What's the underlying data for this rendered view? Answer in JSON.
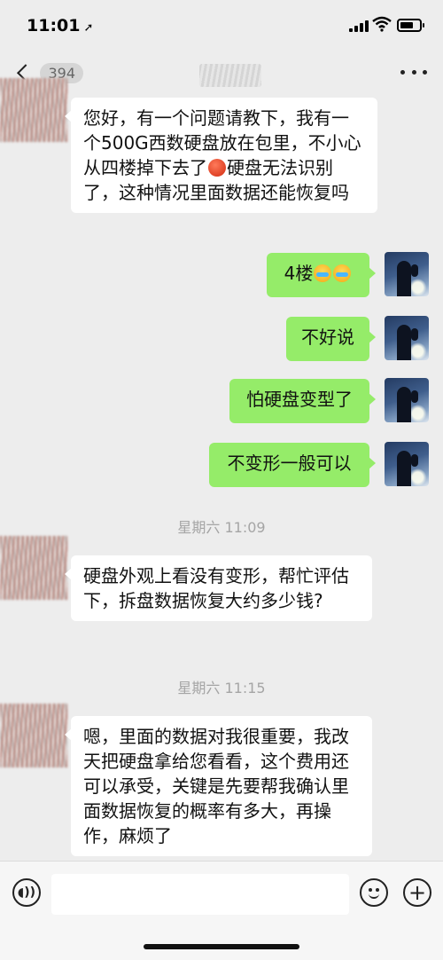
{
  "status": {
    "time": "11:01"
  },
  "nav": {
    "unread_count": "394"
  },
  "messages": [
    {
      "side": "in",
      "text_a": "您好，有一个问题请教下，我有一个500G西数硬盘放在包里，不小心从四楼掉下去了",
      "text_b": "硬盘无法识别了，这种情况里面数据还能恢复吗"
    },
    {
      "side": "out",
      "text": "4楼"
    },
    {
      "side": "out",
      "text": "不好说"
    },
    {
      "side": "out",
      "text": "怕硬盘变型了"
    },
    {
      "side": "out",
      "text": "不变形一般可以"
    },
    {
      "side": "in",
      "text": "硬盘外观上看没有变形，帮忙评估下，拆盘数据恢复大约多少钱?"
    },
    {
      "side": "in",
      "text": "嗯，里面的数据对我很重要，我改天把硬盘拿给您看看，这个费用还可以承受，关键是先要帮我确认里面数据恢复的概率有多大，再操作，麻烦了"
    }
  ],
  "timestamps": [
    "星期六 11:09",
    "星期六 11:15"
  ],
  "icons": {
    "back": "chevron-left-icon",
    "more": "more-icon",
    "voice": "voice-icon",
    "emoji": "emoji-icon",
    "plus": "plus-icon"
  },
  "colors": {
    "background": "#ededed",
    "bubble_out": "#95ec69",
    "bubble_in": "#ffffff"
  }
}
